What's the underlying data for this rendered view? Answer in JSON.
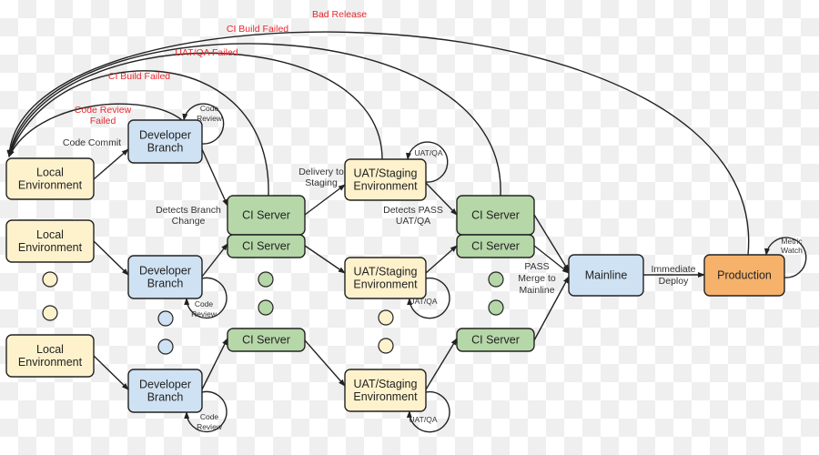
{
  "colors": {
    "local": "#fdf2cc",
    "developer": "#cfe2f3",
    "ci": "#b6d7a8",
    "uat": "#fdf2cc",
    "mainline": "#cfe2f3",
    "production": "#f6b26b",
    "failure_label": "#e8282e",
    "stroke": "#222222"
  },
  "nodes": {
    "local1": [
      "Local",
      "Environment"
    ],
    "local2": [
      "Local",
      "Environment"
    ],
    "local3": [
      "Local",
      "Environment"
    ],
    "dev1": [
      "Developer",
      "Branch"
    ],
    "dev2": [
      "Developer",
      "Branch"
    ],
    "dev3": [
      "Developer",
      "Branch"
    ],
    "ci1": [
      "CI Server"
    ],
    "ci2": [
      "CI Server"
    ],
    "ci3": [
      "CI Server"
    ],
    "uat1": [
      "UAT/Staging",
      "Environment"
    ],
    "uat2": [
      "UAT/Staging",
      "Environment"
    ],
    "uat3": [
      "UAT/Staging",
      "Environment"
    ],
    "ci4": [
      "CI Server"
    ],
    "ci5": [
      "CI Server"
    ],
    "ci6": [
      "CI Server"
    ],
    "mainline": [
      "Mainline"
    ],
    "production": [
      "Production"
    ]
  },
  "edge_labels": {
    "code_commit": [
      "Code Commit"
    ],
    "detects_branch_change": [
      "Detects Branch",
      "Change"
    ],
    "delivery_to_staging": [
      "Delivery to",
      "Staging"
    ],
    "detects_pass": [
      "Detects PASS",
      "UAT/QA"
    ],
    "pass_merge": [
      "PASS",
      "Merge to",
      "Mainline"
    ],
    "immediate_deploy": [
      "Immediate",
      "Deploy"
    ]
  },
  "loop_labels": {
    "code_review": [
      "Code",
      "Review"
    ],
    "uat_qa": [
      "UAT/QA"
    ],
    "metric_watch": [
      "Metric",
      "Watch"
    ]
  },
  "failure_labels": {
    "bad_release": [
      "Bad Release"
    ],
    "ci_build_failed_top": [
      "CI Build Failed"
    ],
    "uat_qa_failed": [
      "UAT/QA Failed"
    ],
    "ci_build_failed": [
      "CI Build Failed"
    ],
    "code_review_failed": [
      "Code Review",
      "Failed"
    ]
  }
}
